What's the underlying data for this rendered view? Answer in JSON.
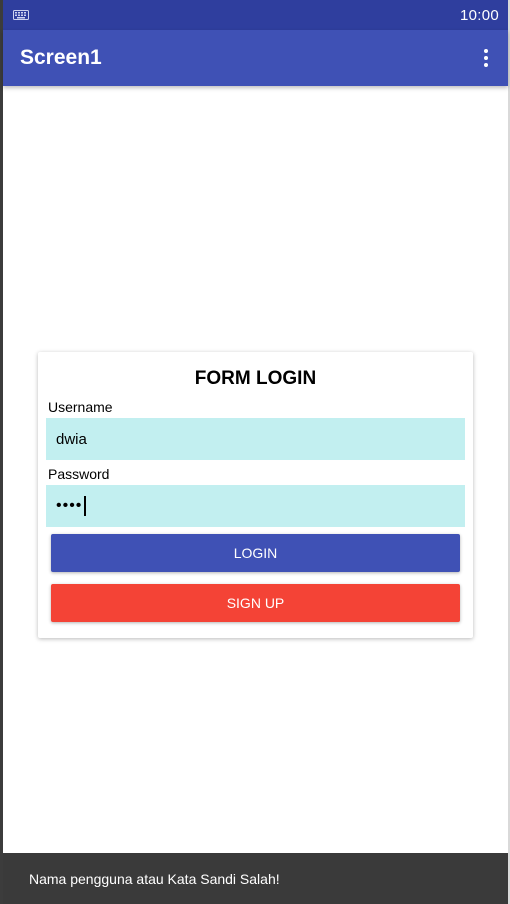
{
  "status_bar": {
    "time": "10:00",
    "left_icon": "keyboard-icon"
  },
  "app_bar": {
    "title": "Screen1",
    "menu_icon": "overflow-menu-icon",
    "color": "#3f51b5"
  },
  "form": {
    "title": "FORM LOGIN",
    "username_label": "Username",
    "username_value": "dwia",
    "password_label": "Password",
    "password_value": "••••",
    "field_color": "#c2eff0"
  },
  "buttons": {
    "login_label": "LOGIN",
    "login_color": "#3f51b5",
    "signup_label": "SIGN UP",
    "signup_color": "#f44336"
  },
  "toast": {
    "message": "Nama pengguna atau Kata Sandi Salah!"
  }
}
